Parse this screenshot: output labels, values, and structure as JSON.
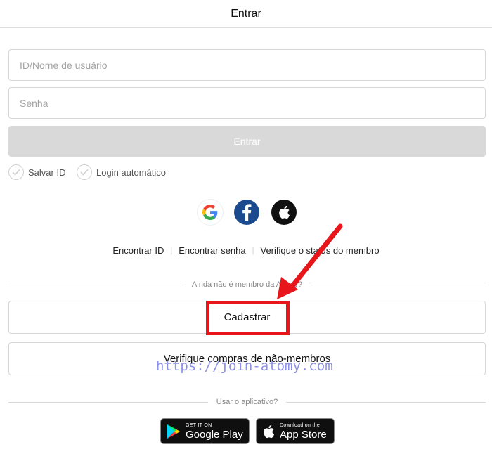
{
  "header": {
    "title": "Entrar"
  },
  "form": {
    "username_placeholder": "ID/Nome de usuário",
    "password_placeholder": "Senha",
    "login_label": "Entrar",
    "save_id_label": "Salvar ID",
    "auto_login_label": "Login automático"
  },
  "links": {
    "find_id": "Encontrar ID",
    "find_password": "Encontrar senha",
    "verify_status": "Verifique o status do membro"
  },
  "member": {
    "divider_text": "Ainda não é membro da Atomy?",
    "register_label": "Cadastrar",
    "nonmember_label": "Verifique compras de não-membros"
  },
  "app": {
    "divider_text": "Usar o aplicativo?",
    "google_small": "GET IT ON",
    "google_big": "Google Play",
    "apple_small": "Download on the",
    "apple_big": "App Store"
  },
  "watermark": {
    "text": "https://join-atomy.com"
  },
  "icons": {
    "social": [
      "google-icon",
      "facebook-icon",
      "apple-icon"
    ],
    "annotation": [
      "red-arrow",
      "red-highlight-box"
    ]
  },
  "colors": {
    "facebook": "#1b4b8e",
    "highlight": "#e8161b",
    "watermark": "#8d91e6",
    "button_disabled": "#d9d9d9"
  }
}
